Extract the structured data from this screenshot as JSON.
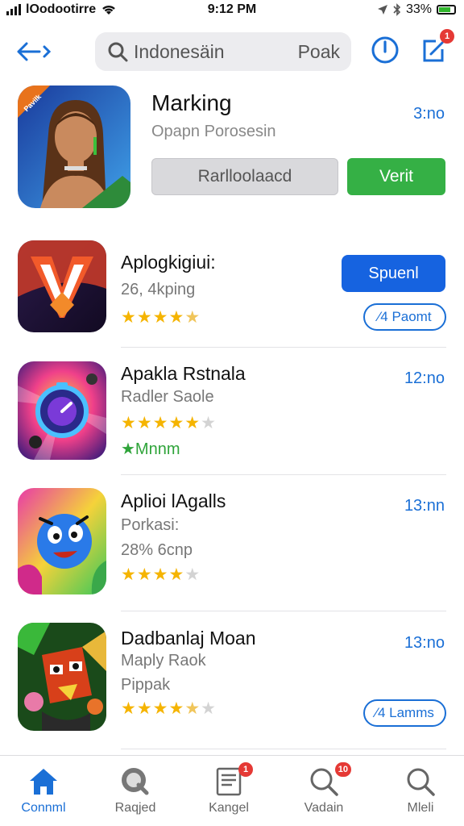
{
  "status_bar": {
    "carrier": "lOodootirre",
    "time": "9:12 PM",
    "battery": "33%"
  },
  "header": {
    "search_placeholder": "Indonesäin",
    "search_suffix": "Poak",
    "notification_count": "1"
  },
  "featured": {
    "title": "Marking",
    "subtitle": "Opapn Porosesin",
    "time": "3:no",
    "icon_badge": "Pavilk",
    "secondary_button": "Rarlloolaacd",
    "primary_button": "Verit"
  },
  "apps": [
    {
      "title": "Aplogkigiui:",
      "line1": "26, 4kping",
      "rating": 4.5,
      "button": "Spuenl",
      "outline_button": "⁄4 Paomt"
    },
    {
      "title": "Apakla Rstnala",
      "line1": "Radler Saole",
      "rating": 4,
      "line2": "★Mnnm",
      "time": "12:no"
    },
    {
      "title": "Aplioi lAgalls",
      "line1": "Porkasi:",
      "line2": "28% 6cnp",
      "rating": 4,
      "time": "13:nn"
    },
    {
      "title": "Dadbanlaj Moan",
      "line1": "Maply Raok",
      "line2": "Pippak",
      "rating": 4.5,
      "time": "13:no",
      "outline_button": "⁄4 Lamms"
    }
  ],
  "tabs": [
    {
      "label": "Connml",
      "icon": "home-icon",
      "active": true
    },
    {
      "label": "Raqjed",
      "icon": "search-icon",
      "active": false
    },
    {
      "label": "Kangel",
      "icon": "document-icon",
      "active": false,
      "badge": "1"
    },
    {
      "label": "Vadain",
      "icon": "search-icon",
      "active": false,
      "badge": "10"
    },
    {
      "label": "Mleli",
      "icon": "search-icon",
      "active": false
    }
  ],
  "colors": {
    "accent_blue": "#1a6fd6",
    "button_blue": "#1663e0",
    "button_green": "#35b045",
    "star": "#f5b400",
    "badge_red": "#e53935"
  }
}
